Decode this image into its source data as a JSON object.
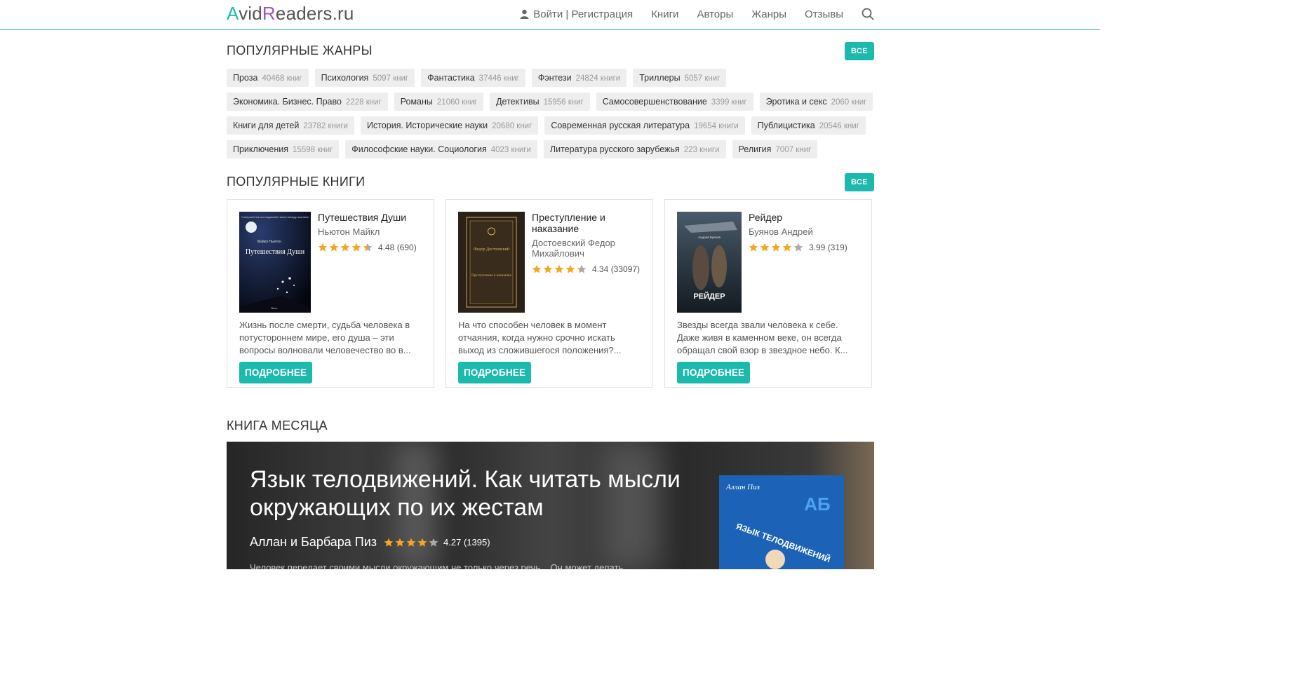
{
  "header": {
    "logo": {
      "a": "A",
      "vid": "vid",
      "r": "R",
      "eaders": "eaders.ru"
    },
    "nav": {
      "login": "Войти | Регистрация",
      "books": "Книги",
      "authors": "Авторы",
      "genres": "Жанры",
      "reviews": "Отзывы"
    }
  },
  "genres_section": {
    "title": "ПОПУЛЯРНЫЕ ЖАНРЫ",
    "all_label": "ВСЕ",
    "items": [
      {
        "name": "Проза",
        "count": "40468 книг"
      },
      {
        "name": "Психология",
        "count": "5097 книг"
      },
      {
        "name": "Фантастика",
        "count": "37446 книг"
      },
      {
        "name": "Фэнтези",
        "count": "24824 книги"
      },
      {
        "name": "Триллеры",
        "count": "5057 книг"
      },
      {
        "name": "Экономика. Бизнес. Право",
        "count": "2228 книг"
      },
      {
        "name": "Романы",
        "count": "21060 книг"
      },
      {
        "name": "Детективы",
        "count": "15956 книг"
      },
      {
        "name": "Самосовершенствование",
        "count": "3399 книг"
      },
      {
        "name": "Эротика и секс",
        "count": "2060 книг"
      },
      {
        "name": "Книги для детей",
        "count": "23782 книги"
      },
      {
        "name": "История. Исторические науки",
        "count": "20680 книг"
      },
      {
        "name": "Современная русская литература",
        "count": "19654 книги"
      },
      {
        "name": "Публицистика",
        "count": "20546 книг"
      },
      {
        "name": "Приключения",
        "count": "15598 книг"
      },
      {
        "name": "Философские науки. Социология",
        "count": "4023 книги"
      },
      {
        "name": "Литература русского зарубежья",
        "count": "223 книги"
      },
      {
        "name": "Религия",
        "count": "7007 книг"
      }
    ]
  },
  "books_section": {
    "title": "ПОПУЛЯРНЫЕ КНИГИ",
    "all_label": "ВСЕ",
    "more_label": "ПОДРОБНЕЕ",
    "star_color": "#f5a623",
    "books": [
      {
        "title": "Путешествия Души",
        "author": "Ньютон Майкл",
        "rating": 4.48,
        "rating_text": "4.48 (690)",
        "description": "Жизнь после смерти, судьба человека в потустороннем мире, его душа – эти вопросы волновали человечество во в...",
        "cover": {
          "top": "Совершенное исследование жизни между жизнями",
          "author": "Майкл Ньютон",
          "title": "Путешествия Души",
          "publisher": "Весь"
        }
      },
      {
        "title": "Преступление и наказание",
        "author": "Достоевский Федор Михайлович",
        "rating": 4.34,
        "rating_text": "4.34 (33097)",
        "description": "На что способен человек в момент отчаяния, когда нужно срочно искать выход из сложившегося положения?...",
        "cover": {
          "author": "Федор Достоевский",
          "title": "Преступление и наказание"
        }
      },
      {
        "title": "Рейдер",
        "author": "Буянов Андрей",
        "rating": 3.99,
        "rating_text": "3.99 (319)",
        "description": "Звезды всегда звали человека к себе. Даже живя в каменном веке, он всегда обращал свой взор в звездное небо. К...",
        "cover": {
          "author": "Андрей Буянов",
          "title": "РЕЙДЕР"
        }
      }
    ]
  },
  "month_section": {
    "title": "КНИГА МЕСЯЦА",
    "book_title": "Язык телодвижений. Как читать мысли окружающих по их жестам",
    "author": "Аллан и Барбара Пиз",
    "rating": 4.27,
    "rating_text": "4.27 (1395)",
    "description": "Человек передает своими мысли окружающим не только через речь... Он может делать",
    "cover": {
      "author": "Аллан Пиз",
      "title": "ЯЗЫК ТЕЛОДВИЖЕНИЙ",
      "badge": "АБ"
    }
  },
  "colors": {
    "accent": "#1cb9ad",
    "logo_r": "#9b59b6",
    "star": "#f5a623"
  }
}
